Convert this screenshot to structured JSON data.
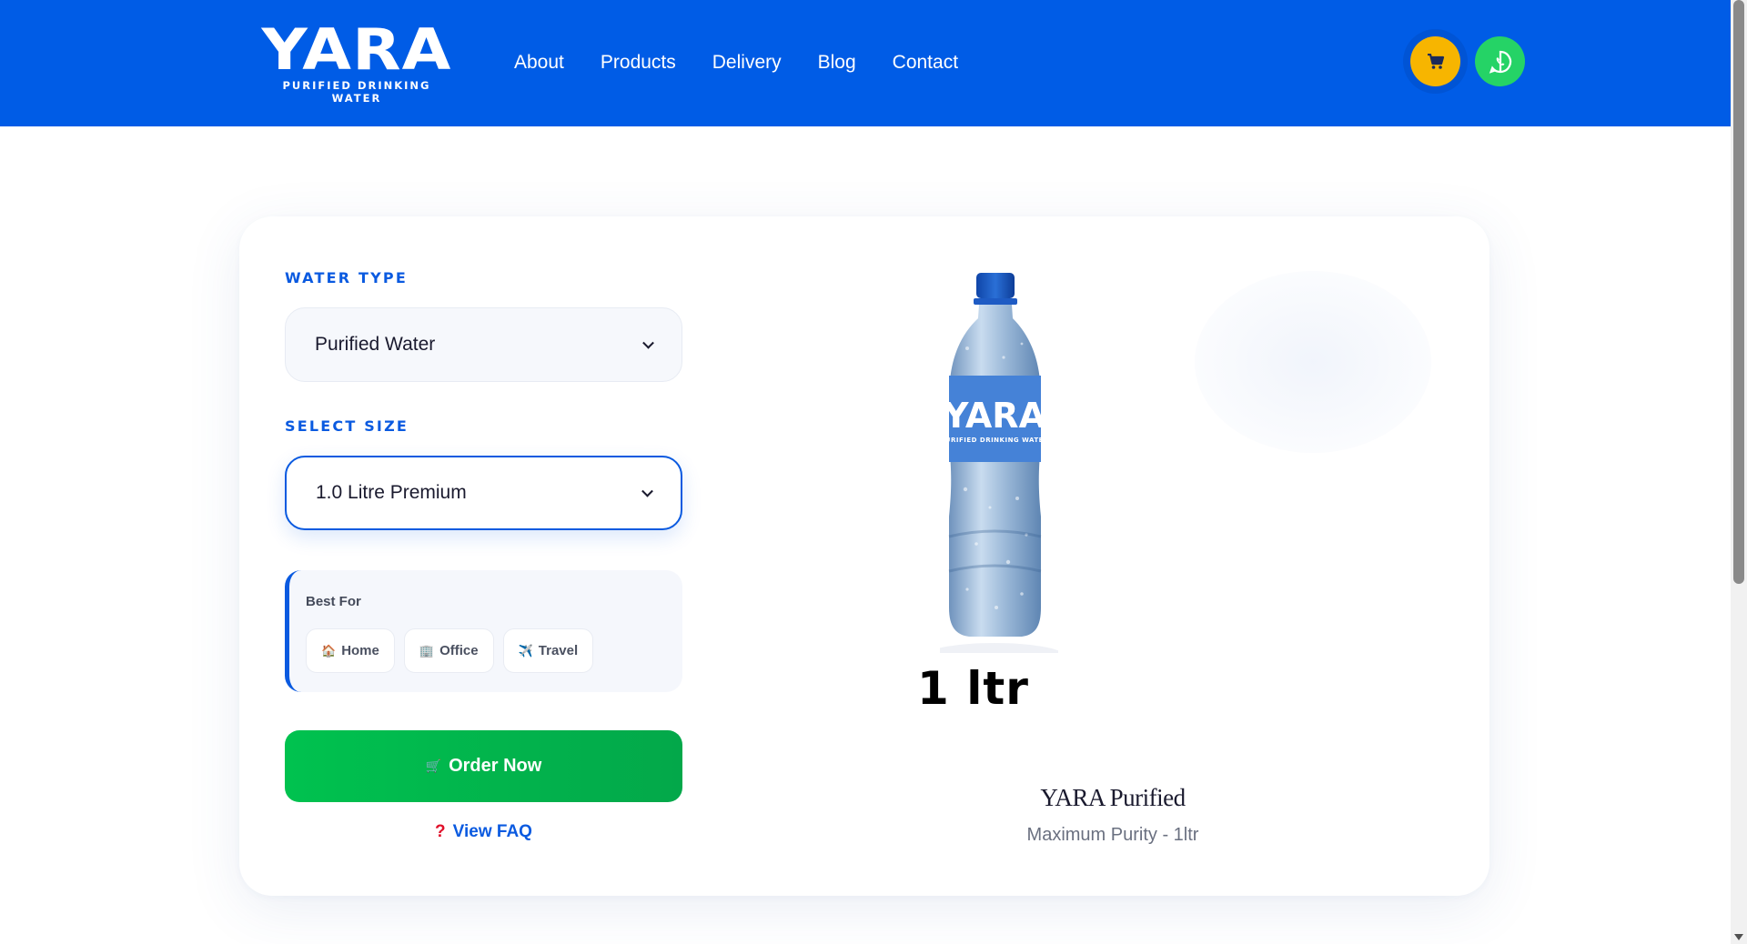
{
  "brand": {
    "name": "YARA",
    "tagline": "PURIFIED DRINKING WATER"
  },
  "nav": {
    "items": [
      {
        "label": "About"
      },
      {
        "label": "Products"
      },
      {
        "label": "Delivery"
      },
      {
        "label": "Blog"
      },
      {
        "label": "Contact"
      }
    ]
  },
  "header_actions": {
    "cart_icon": "cart-icon",
    "whatsapp_icon": "whatsapp-icon",
    "cart_color": "#f7b500",
    "whatsapp_color": "#25d366"
  },
  "form": {
    "water_type_label": "WATER TYPE",
    "water_type_value": "Purified Water",
    "size_label": "SELECT SIZE",
    "size_value": "1.0 Litre Premium",
    "best_for": {
      "title": "Best For",
      "chips": [
        {
          "emoji": "🏠",
          "label": "Home"
        },
        {
          "emoji": "🏢",
          "label": "Office"
        },
        {
          "emoji": "✈️",
          "label": "Travel"
        }
      ]
    },
    "order_emoji": "🛒",
    "order_label": "Order Now",
    "faq_mark": "?",
    "faq_label": "View FAQ"
  },
  "product": {
    "bottle_brand": "YARA",
    "bottle_tagline": "PURIFIED DRINKING WATER",
    "size_caption": "1 ltr",
    "name": "YARA Purified",
    "description": "Maximum Purity - 1ltr"
  },
  "colors": {
    "header_bg": "#005ce6",
    "accent": "#0a5ae0",
    "order_button": "#00c24f",
    "faq_mark": "#e0102a"
  }
}
